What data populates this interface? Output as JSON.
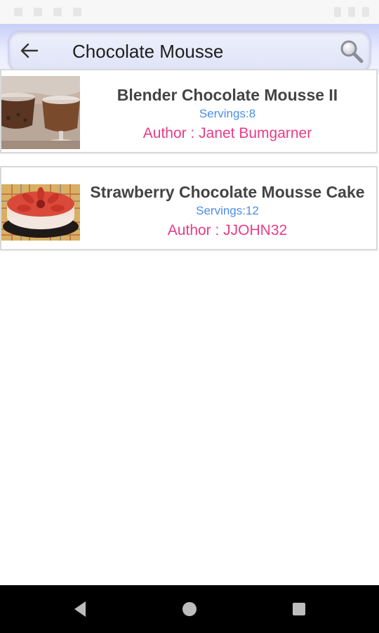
{
  "search": {
    "query": "Chocolate Mousse",
    "back_icon": "arrow-left-icon",
    "search_icon": "magnifier-icon"
  },
  "results": [
    {
      "title": "Blender Chocolate Mousse II",
      "servings": "Servings:8",
      "author": "Author : Janet Bumgarner",
      "image": "chocolate-mousse-glasses-photo"
    },
    {
      "title": "Strawberry Chocolate Mousse Cake",
      "servings": "Servings:12",
      "author": "Author : JJOHN32",
      "image": "strawberry-mousse-cake-photo"
    }
  ],
  "nav": {
    "back_icon": "triangle-back-icon",
    "home_icon": "circle-home-icon",
    "recents_icon": "square-recents-icon"
  },
  "colors": {
    "title": "#444444",
    "servings": "#4a8ee6",
    "author": "#e83c86",
    "header": "#c8cff8"
  }
}
